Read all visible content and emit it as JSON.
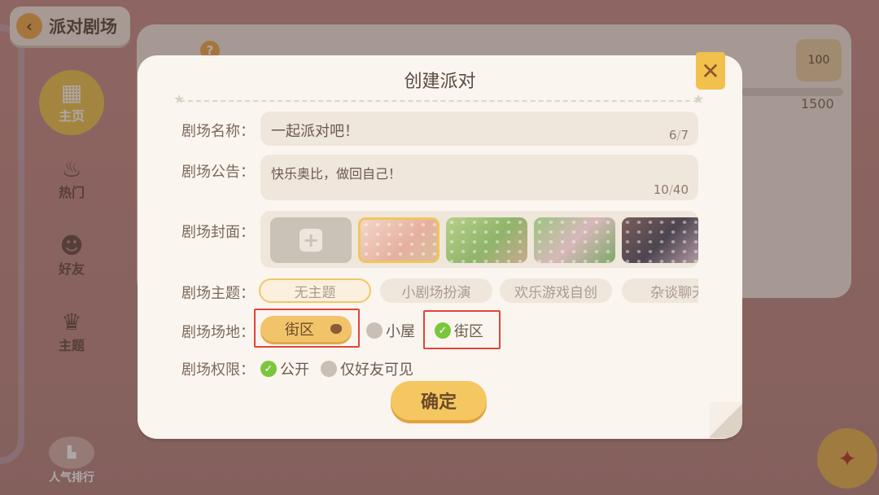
{
  "background": {
    "back_label": "派对剧场",
    "nav": [
      "主页",
      "热门",
      "好友",
      "主题"
    ],
    "rank_label": "人气排行",
    "help_glyph": "?",
    "star_badge": "100",
    "score": "1500"
  },
  "modal": {
    "title": "创建派对",
    "close_glyph": "✕",
    "name": {
      "label": "剧场名称：",
      "value": "一起派对吧！",
      "count": "6",
      "max": "7"
    },
    "notice": {
      "label": "剧场公告：",
      "value": "快乐奥比，做回自己！",
      "count": "10",
      "max": "40"
    },
    "cover": {
      "label": "剧场封面："
    },
    "theme": {
      "label": "剧场主题：",
      "chips": [
        "无主题",
        "小剧场扮演",
        "欢乐游戏自创",
        "杂谈聊天"
      ]
    },
    "venue": {
      "label": "剧场场地：",
      "selected_label": "街区",
      "option_house": "小屋",
      "option_street": "街区"
    },
    "permission": {
      "label": "剧场权限：",
      "option_public": "公开",
      "option_friends": "仅好友可见"
    },
    "confirm_label": "确定"
  },
  "colors": {
    "accent": "#f5c761",
    "check_green": "#7cc63e",
    "highlight_red": "#e0453a"
  }
}
